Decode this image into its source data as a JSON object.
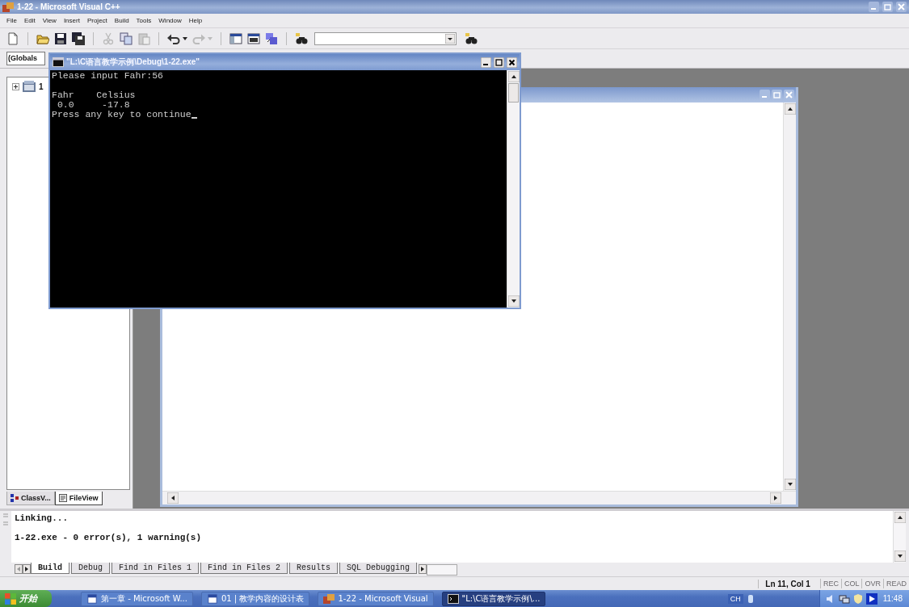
{
  "window": {
    "title": "1-22 - Microsoft Visual C++"
  },
  "menu": [
    "File",
    "Edit",
    "View",
    "Insert",
    "Project",
    "Build",
    "Tools",
    "Window",
    "Help"
  ],
  "wizard_bar": {
    "scope": "(Globals"
  },
  "workspace": {
    "tree": [
      {
        "label": "1",
        "expanded": false
      }
    ],
    "tabs": [
      {
        "label": "ClassV...",
        "selected": false
      },
      {
        "label": "FileView",
        "selected": true
      }
    ]
  },
  "console": {
    "title": "\"L:\\C语言教学示例\\Debug\\1-22.exe\"",
    "blocks": [
      [
        "Please input Fahr:56"
      ],
      [
        "Fahr    Celsius",
        " 0.0     -17.8",
        "Press any key to continue"
      ]
    ],
    "cursor": true
  },
  "output": {
    "blocks": [
      [
        "Linking..."
      ],
      [
        "1-22.exe - 0 error(s), 1 warning(s)"
      ]
    ],
    "tabs": [
      {
        "label": "Build",
        "selected": true
      },
      {
        "label": "Debug",
        "selected": false
      },
      {
        "label": "Find in Files 1",
        "selected": false
      },
      {
        "label": "Find in Files 2",
        "selected": false
      },
      {
        "label": "Results",
        "selected": false
      },
      {
        "label": "SQL Debugging",
        "selected": false
      }
    ]
  },
  "status_bar": {
    "position": "Ln 11, Col 1",
    "indicators": [
      {
        "label": "REC",
        "on": false
      },
      {
        "label": "COL",
        "on": false
      },
      {
        "label": "OVR",
        "on": false
      },
      {
        "label": "READ",
        "on": false
      }
    ]
  },
  "taskbar": {
    "start": "开始",
    "tasks": [
      {
        "label": "第一章 - Microsoft W...",
        "selected": false
      },
      {
        "label": "01 | 教学内容的设计表",
        "selected": false
      },
      {
        "label": "1-22 - Microsoft Visual",
        "selected": false
      },
      {
        "label": "\"L:\\C语言教学示例\\...",
        "selected": true
      }
    ],
    "tray": {
      "input_language": "CH",
      "clock": "11:48"
    }
  }
}
